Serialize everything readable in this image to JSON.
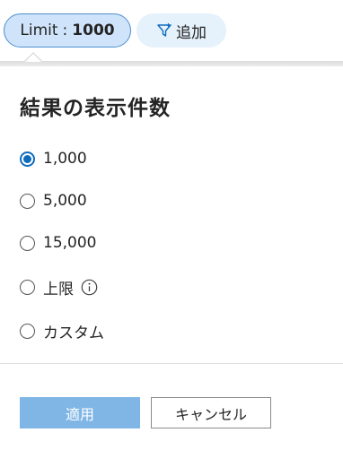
{
  "toolbar": {
    "limit_key": "Limit",
    "limit_sep": ":",
    "limit_value": "1000",
    "add_label": "追加"
  },
  "panel": {
    "title": "結果の表示件数",
    "options": [
      {
        "label": "1,000",
        "selected": true
      },
      {
        "label": "5,000",
        "selected": false
      },
      {
        "label": "15,000",
        "selected": false
      },
      {
        "label": "上限",
        "selected": false
      },
      {
        "label": "カスタム",
        "selected": false
      }
    ],
    "apply_label": "適用",
    "cancel_label": "キャンセル"
  },
  "colors": {
    "accent": "#0f6cbd",
    "pill_active_bg": "#cfe4fa",
    "pill_bg": "#e5f1fb",
    "apply_disabled_bg": "#7fb6e6"
  },
  "icons": [
    "filter-icon",
    "info-icon"
  ]
}
